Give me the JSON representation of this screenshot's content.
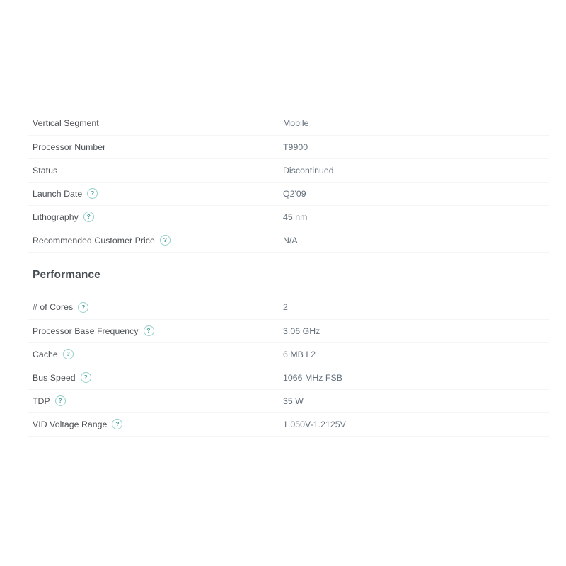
{
  "accent_colors": {
    "label_text": "#4b5055",
    "value_text": "#63707c",
    "heading_text": "#4a4f54",
    "help_icon_border": "#96cfc9",
    "help_icon_glyph": "#3d9e96",
    "row_divider": "#f4f5f6",
    "page_background": "#ffffff"
  },
  "help_icon_glyph": "?",
  "sections": [
    {
      "id": "essentials",
      "heading": "",
      "rows": [
        {
          "label": "Vertical Segment",
          "value": "Mobile",
          "has_help": false
        },
        {
          "label": "Processor Number",
          "value": "T9900",
          "has_help": false
        },
        {
          "label": "Status",
          "value": "Discontinued",
          "has_help": false
        },
        {
          "label": "Launch Date",
          "value": "Q2'09",
          "has_help": true
        },
        {
          "label": "Lithography",
          "value": "45 nm",
          "has_help": true
        },
        {
          "label": "Recommended Customer Price",
          "value": "N/A",
          "has_help": true
        }
      ]
    },
    {
      "id": "performance",
      "heading": "Performance",
      "rows": [
        {
          "label": "# of Cores",
          "value": "2",
          "has_help": true
        },
        {
          "label": "Processor Base Frequency",
          "value": "3.06 GHz",
          "has_help": true
        },
        {
          "label": "Cache",
          "value": "6 MB L2",
          "has_help": true
        },
        {
          "label": "Bus Speed",
          "value": "1066 MHz FSB",
          "has_help": true
        },
        {
          "label": "TDP",
          "value": "35 W",
          "has_help": true
        },
        {
          "label": "VID Voltage Range",
          "value": "1.050V-1.2125V",
          "has_help": true
        }
      ]
    }
  ]
}
